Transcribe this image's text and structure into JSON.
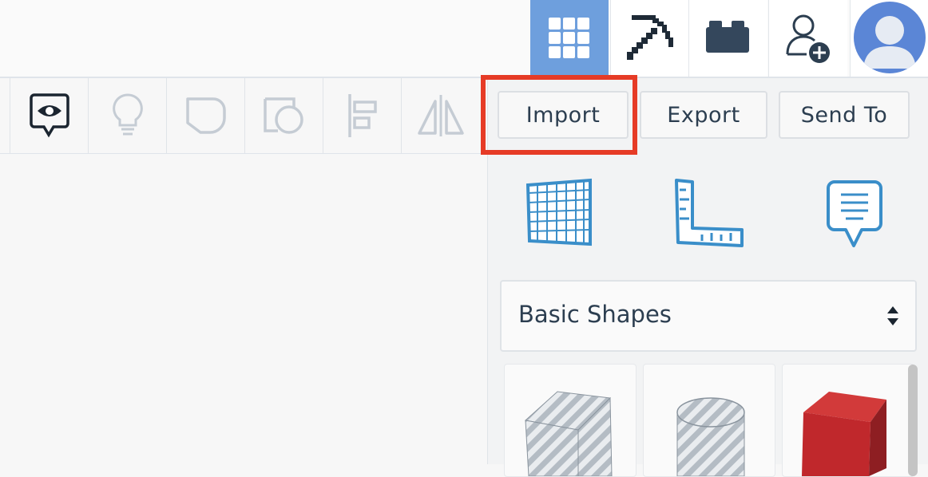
{
  "toolbar": {
    "import_label": "Import",
    "export_label": "Export",
    "send_to_label": "Send To"
  },
  "shapes_panel": {
    "category_selected": "Basic Shapes"
  },
  "colors": {
    "active_view": "#6e9fdd",
    "highlight": "#e63b26",
    "avatar": "#5b86d6",
    "accent_blue": "#3a8ec9",
    "box_red": "#c0282c"
  },
  "icons": {
    "top": [
      "3d-grid-view-icon",
      "pickaxe-icon",
      "brick-icon",
      "add-user-icon",
      "avatar"
    ],
    "tools": [
      "notes-eye-icon",
      "lightbulb-icon",
      "group-shape-icon",
      "hole-shape-icon",
      "align-icon",
      "mirror-icon"
    ],
    "panel": [
      "workplane-grid-icon",
      "ruler-icon",
      "note-icon"
    ]
  }
}
